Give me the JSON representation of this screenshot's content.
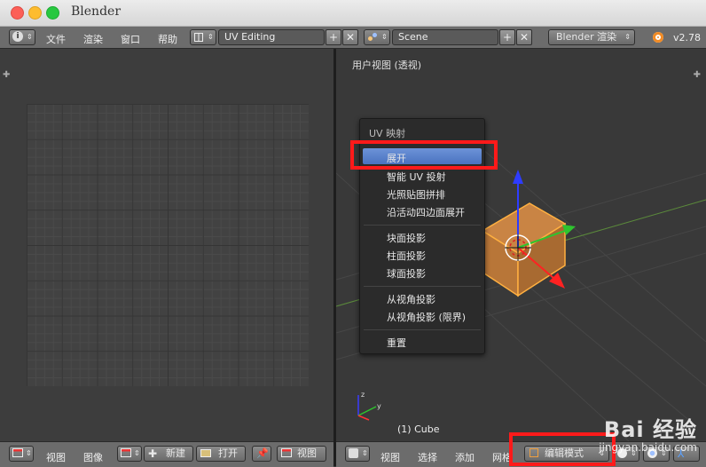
{
  "window": {
    "title": "Blender"
  },
  "topbar": {
    "menu": [
      "文件",
      "渲染",
      "窗口",
      "帮助"
    ],
    "screen_layout": "UV Editing",
    "scene": "Scene",
    "render_engine": "Blender 渲染",
    "version": "v2.78"
  },
  "viewport": {
    "title": "用户视图 (透视)",
    "object_label": "(1) Cube"
  },
  "uv_menu": {
    "title": "UV 映射",
    "items": [
      "展开",
      "智能 UV 投射",
      "光照贴图拼排",
      "沿活动四边面展开",
      "块面投影",
      "柱面投影",
      "球面投影",
      "从视角投影",
      "从视角投影 (限界)",
      "重置"
    ]
  },
  "left_bottombar": {
    "view": "视图",
    "image": "图像",
    "new": "新建",
    "open": "打开",
    "view2": "视图"
  },
  "right_bottombar": {
    "view": "视图",
    "select": "选择",
    "add": "添加",
    "mesh": "网格",
    "mode": "编辑模式"
  },
  "watermark": {
    "text": "Bai 经验",
    "url": "jingyan.baidu.com"
  },
  "colors": {
    "highlight": "#5b82cc",
    "annotation": "#ff1a1a",
    "cube_face": "#d7863a"
  }
}
